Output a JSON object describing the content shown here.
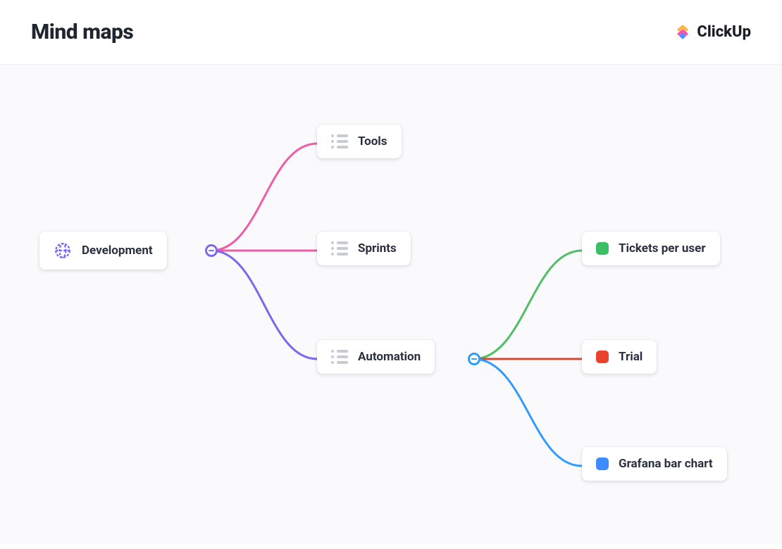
{
  "header": {
    "title": "Mind maps",
    "brand": "ClickUp"
  },
  "nodes": {
    "root": {
      "label": "Development"
    },
    "tools": {
      "label": "Tools"
    },
    "sprints": {
      "label": "Sprints"
    },
    "automation": {
      "label": "Automation"
    },
    "tickets": {
      "label": "Tickets per user"
    },
    "trial": {
      "label": "Trial"
    },
    "grafana": {
      "label": "Grafana bar chart"
    }
  },
  "colors": {
    "edge_pink": "#ef5da8",
    "edge_purple": "#7b68ee",
    "edge_green": "#4fbf67",
    "edge_red": "#d24a30",
    "edge_blue": "#2f9bff"
  }
}
